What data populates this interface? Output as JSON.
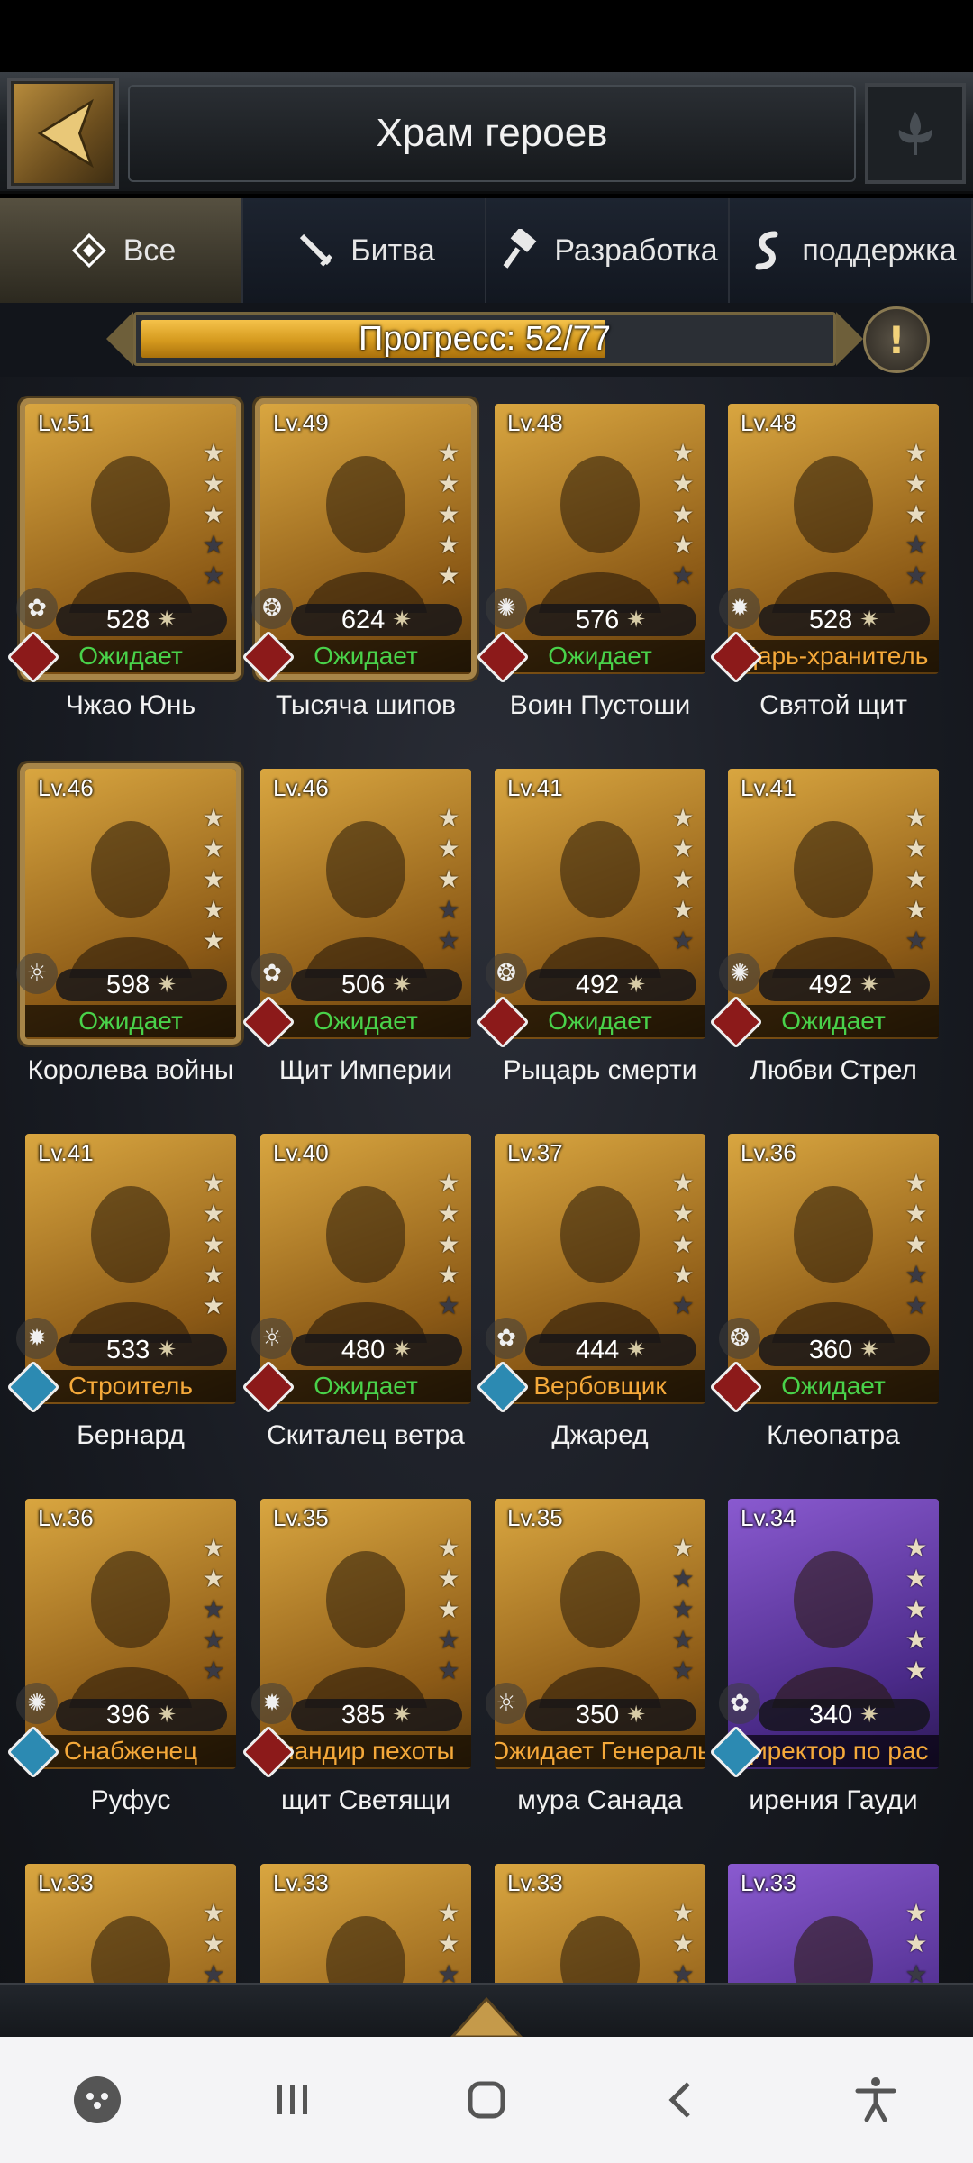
{
  "header": {
    "title": "Храм героев",
    "back_icon": "chevron-left-icon",
    "right_icon": "fleur-icon"
  },
  "tabs": [
    {
      "label": "Все",
      "icon": "diamond-icon",
      "active": true
    },
    {
      "label": "Битва",
      "icon": "sword-icon",
      "active": false
    },
    {
      "label": "Разработка",
      "icon": "hammer-icon",
      "active": false
    },
    {
      "label": "поддержка",
      "icon": "scroll-icon",
      "active": false
    }
  ],
  "progress": {
    "label": "Прогресс: 52/77",
    "current": 52,
    "total": 77,
    "info_symbol": "!"
  },
  "heroes": [
    {
      "lv": "Lv.51",
      "power": "528",
      "status": "Ожидает",
      "status_color": "green",
      "badge": "red",
      "name": "Чжао Юнь",
      "stars": 3,
      "frame": "gold-framed"
    },
    {
      "lv": "Lv.49",
      "power": "624",
      "status": "Ожидает",
      "status_color": "green",
      "badge": "red",
      "name": "Тысяча шипов",
      "stars": 5,
      "frame": "gold-framed"
    },
    {
      "lv": "Lv.48",
      "power": "576",
      "status": "Ожидает",
      "status_color": "green",
      "badge": "red",
      "name": "Воин Пустоши",
      "stars": 4,
      "frame": "gold"
    },
    {
      "lv": "Lv.48",
      "power": "528",
      "status": "Царь-хранитель",
      "status_color": "orange",
      "badge": "red",
      "name": "Святой щит",
      "stars": 3,
      "frame": "gold"
    },
    {
      "lv": "Lv.46",
      "power": "598",
      "status": "Ожидает",
      "status_color": "green",
      "badge": "none",
      "name": "Королева войны",
      "stars": 5,
      "frame": "gold-framed"
    },
    {
      "lv": "Lv.46",
      "power": "506",
      "status": "Ожидает",
      "status_color": "green",
      "badge": "red",
      "name": "Щит Империи",
      "stars": 3,
      "frame": "gold"
    },
    {
      "lv": "Lv.41",
      "power": "492",
      "status": "Ожидает",
      "status_color": "green",
      "badge": "red",
      "name": "Рыцарь смерти",
      "stars": 4,
      "frame": "gold"
    },
    {
      "lv": "Lv.41",
      "power": "492",
      "status": "Ожидает",
      "status_color": "green",
      "badge": "red",
      "name": "Любви Стрел",
      "stars": 4,
      "frame": "gold"
    },
    {
      "lv": "Lv.41",
      "power": "533",
      "status": "Строитель",
      "status_color": "orange",
      "badge": "teal",
      "name": "Бернард",
      "stars": 5,
      "frame": "gold"
    },
    {
      "lv": "Lv.40",
      "power": "480",
      "status": "Ожидает",
      "status_color": "green",
      "badge": "red",
      "name": "Скиталец ветра",
      "stars": 4,
      "frame": "gold"
    },
    {
      "lv": "Lv.37",
      "power": "444",
      "status": "Вербовщик",
      "status_color": "orange",
      "badge": "teal",
      "name": "Джаред",
      "stars": 4,
      "frame": "gold"
    },
    {
      "lv": "Lv.36",
      "power": "360",
      "status": "Ожидает",
      "status_color": "green",
      "badge": "red",
      "name": "Клеопатра",
      "stars": 3,
      "frame": "gold"
    },
    {
      "lv": "Lv.36",
      "power": "396",
      "status": "Снабженец",
      "status_color": "orange",
      "badge": "teal",
      "name": "Руфус",
      "stars": 2,
      "frame": "gold"
    },
    {
      "lv": "Lv.35",
      "power": "385",
      "status": "мандир пехоты",
      "status_color": "orange",
      "badge": "red",
      "name": "щит Светящи",
      "stars": 3,
      "frame": "gold"
    },
    {
      "lv": "Lv.35",
      "power": "350",
      "status": "Ожидает Генераль",
      "status_color": "orange",
      "badge": "none",
      "name": "мура Санада",
      "stars": 1,
      "frame": "gold"
    },
    {
      "lv": "Lv.34",
      "power": "340",
      "status": "директор по рас",
      "status_color": "orange",
      "badge": "teal",
      "name": "ирения Гауди",
      "stars": 5,
      "frame": "purple"
    },
    {
      "lv": "Lv.33",
      "power": "",
      "status": "",
      "status_color": "green",
      "badge": "none",
      "name": "",
      "stars": 2,
      "frame": "gold"
    },
    {
      "lv": "Lv.33",
      "power": "",
      "status": "",
      "status_color": "green",
      "badge": "none",
      "name": "",
      "stars": 2,
      "frame": "gold"
    },
    {
      "lv": "Lv.33",
      "power": "",
      "status": "",
      "status_color": "green",
      "badge": "none",
      "name": "",
      "stars": 2,
      "frame": "gold"
    },
    {
      "lv": "Lv.33",
      "power": "",
      "status": "",
      "status_color": "green",
      "badge": "none",
      "name": "",
      "stars": 2,
      "frame": "purple"
    }
  ],
  "navbar": {
    "items": [
      "game-launcher-icon",
      "recent-apps-icon",
      "home-icon",
      "back-icon",
      "accessibility-icon"
    ]
  }
}
